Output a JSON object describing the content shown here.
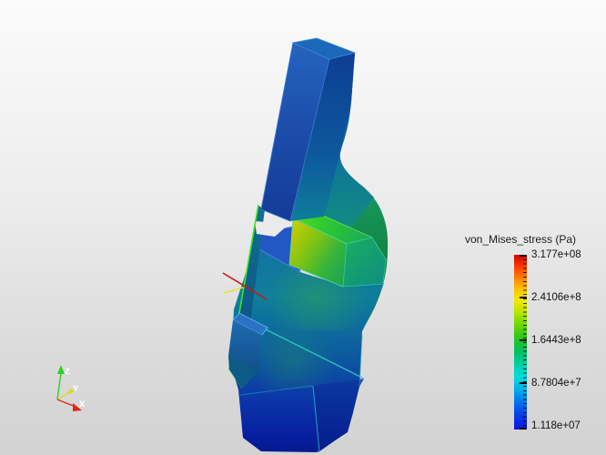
{
  "view": {
    "background_top_color": "#fbfbfb",
    "background_bottom_color": "#d2d2d2"
  },
  "legend": {
    "title": "von_Mises_stress (Pa)",
    "ticks": [
      "3.177e+08",
      "2.4106e+8",
      "1.6443e+8",
      "8.7804e+7",
      "1.118e+07"
    ],
    "colormap_top_to_bottom": [
      "#d40000",
      "#ff8800",
      "#f4e800",
      "#6cd800",
      "#00c05c",
      "#00dcdc",
      "#0064ec",
      "#0a18d8"
    ]
  },
  "triad": {
    "x": {
      "label": "X",
      "color": "#e02818"
    },
    "y": {
      "label": "Y",
      "color": "#ddd82a"
    },
    "z": {
      "label": "Z",
      "color": "#2fd01f"
    }
  },
  "widgets": {
    "probe_line_color": "#cf1810",
    "short_axis_color": "#e6e23c",
    "plane_edge_color": "#3ae81e"
  },
  "model": {
    "low_stress_color": "#143c96",
    "mid_stress_color": "#0f7e9a",
    "high_stress_color": "#c3cb04",
    "edge_highlight_color": "#2ad4c4"
  },
  "chart_data": {
    "type": "heatmap",
    "title": "von_Mises_stress (Pa)",
    "colormap": "jet (blue=low, red=high)",
    "range_pa": [
      11180000,
      317700000
    ],
    "tick_values_pa": [
      317700000,
      241060000,
      164430000,
      87804000,
      11180000
    ],
    "tick_labels": [
      "3.177e+08",
      "2.4106e+8",
      "1.6443e+8",
      "8.7804e+7",
      "1.118e+07"
    ],
    "legend_position": "right",
    "description": "3D finite-element von Mises stress field on a clamp/vise assembly; most of the body is low-stress blue/teal, with a green-yellow high-stress concentration on the middle jaw block."
  }
}
